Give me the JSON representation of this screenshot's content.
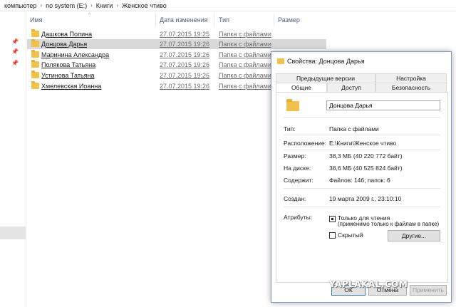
{
  "breadcrumb": [
    "компьютер",
    "no system (E:)",
    "Книги",
    "Женское чтиво"
  ],
  "columns": {
    "name": "Имя",
    "date": "Дата изменения",
    "type": "Тип",
    "size": "Размер"
  },
  "rows": [
    {
      "name": "Дашкова Полина",
      "date": "27.07.2015 19:25",
      "type": "Папка с файлами"
    },
    {
      "name": "Донцова Дарья",
      "date": "27.07.2015 19:26",
      "type": "Папка с файлами"
    },
    {
      "name": "Маринина Александра",
      "date": "27.07.2015 19:26",
      "type": "Папка с файлами"
    },
    {
      "name": "Полякова Татьяна",
      "date": "27.07.2015 19:26",
      "type": "Папка с файлами"
    },
    {
      "name": "Устинова Татьяна",
      "date": "27.07.2015 19:26",
      "type": "Папка с файлами"
    },
    {
      "name": "Хмелевская Иоанна",
      "date": "27.07.2015 19:26",
      "type": "Папка с файлами"
    }
  ],
  "dialog": {
    "title": "Свойства: Донцова Дарья",
    "tabs_top": [
      "Предыдущие версии",
      "Настройка"
    ],
    "tabs_bottom": [
      "Общие",
      "Доступ",
      "Безопасность"
    ],
    "folder_name": "Донцова Дарья",
    "fields": [
      {
        "label": "Тип:",
        "value": "Папка с файлами"
      },
      {
        "label": "Расположение:",
        "value": "E:\\Книги\\Женское чтиво"
      },
      {
        "label": "Размер:",
        "value": "38,3 МБ (40 220 772 байт)"
      },
      {
        "label": "На диске:",
        "value": "38,6 МБ (40 525 824 байт)"
      },
      {
        "label": "Содержит:",
        "value": "Файлов: 146; папок: 6"
      },
      {
        "label": "Создан:",
        "value": "19 марта 2009 г., 23:10:10"
      }
    ],
    "attributes_label": "Атрибуты:",
    "readonly_label": "Только для чтения",
    "readonly_note": "(применимо только к файлам в папке)",
    "hidden_label": "Скрытый",
    "other_button": "Другие...",
    "ok_button": "ОК",
    "cancel_button": "Отмена",
    "apply_button": "Применить"
  },
  "watermark": "YAPLAKAL.COM"
}
